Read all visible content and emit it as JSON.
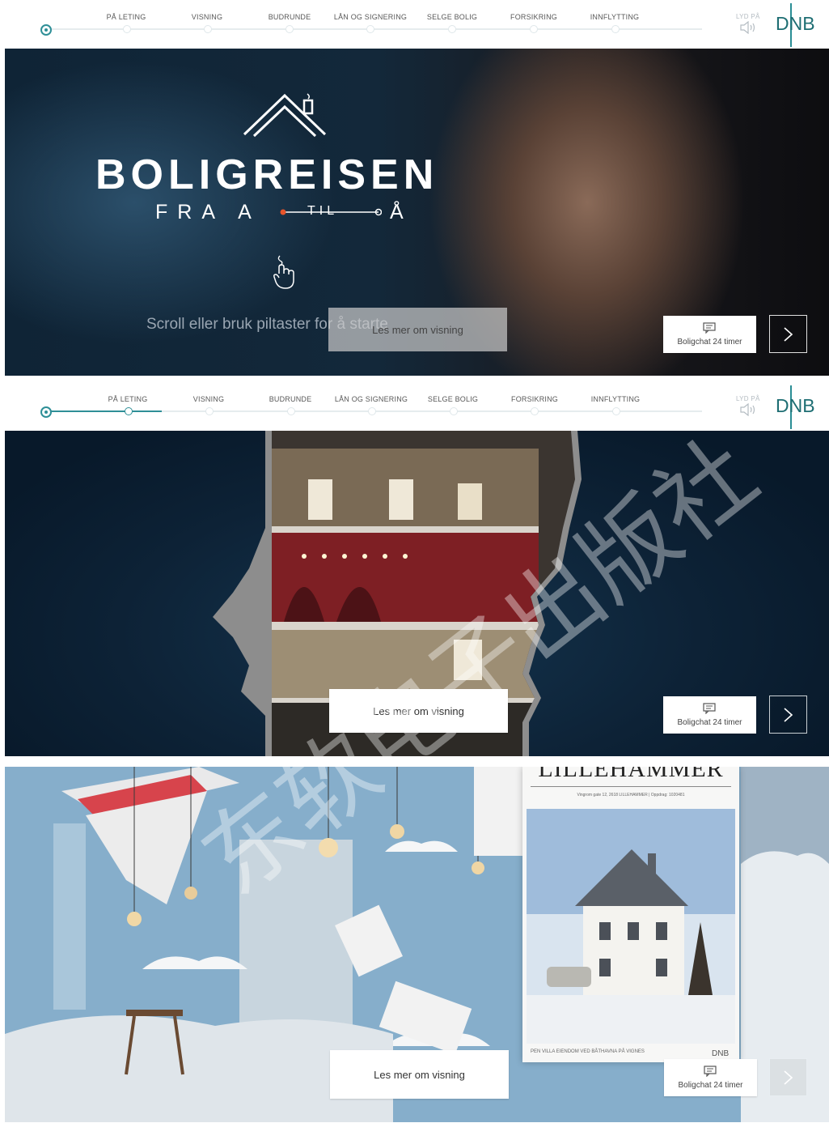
{
  "nav": {
    "items": [
      "PÅ LETING",
      "VISNING",
      "BUDRUNDE",
      "LÅN OG SIGNERING",
      "SELGE BOLIG",
      "FORSIKRING",
      "INNFLYTTING"
    ],
    "sound_label": "LYD PÅ",
    "logo_text": "DNB"
  },
  "hero": {
    "title": "BOLIGREISEN",
    "sub_left": "FRA  A",
    "sub_mid": "TIL",
    "sub_right": "Å",
    "hint": "Scroll eller bruk piltaster for å starte"
  },
  "slides": [
    {
      "cta_label": "Les mer om visning",
      "chat_label": "Boligchat 24 timer"
    },
    {
      "cta_label": "Les mer om visning",
      "chat_label": "Boligchat 24 timer"
    },
    {
      "cta_label": "Les mer om visning",
      "chat_label": "Boligchat 24 timer"
    }
  ],
  "brochure": {
    "title": "LILLEHAMMER",
    "address": "Vingrom gate 12, 2618 LILLEHAMMER  |  Oppdrag: 1020481",
    "caption": "PEN VILLA EIENDOM VED BÅTHAVNA PÅ VIGNES",
    "logo": "DNB"
  },
  "watermark": "东软电子出版社",
  "colors": {
    "accent": "#2f8f97",
    "dnb_green": "#1e6e73"
  }
}
